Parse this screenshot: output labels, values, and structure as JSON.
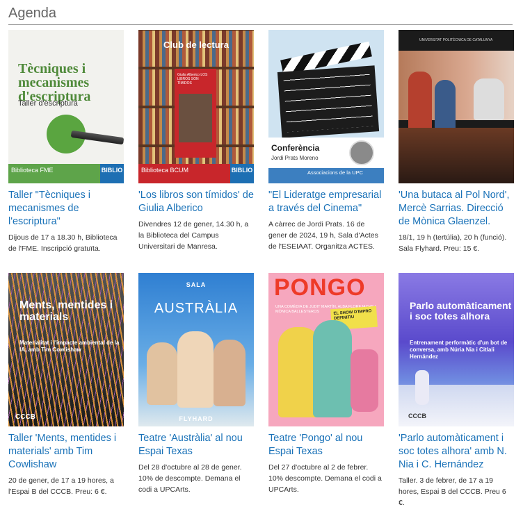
{
  "header": {
    "title": "Agenda"
  },
  "items": [
    {
      "title": "Taller \"Tècniques i mecanismes de l'escriptura\"",
      "desc": "Dijous de 17 a 18.30 h, Biblioteca de l'FME. Inscripció gratuïta.",
      "poster": {
        "heading": "Tècniques i mecanismes d'escriptura",
        "sub": "Taller d'escriptura",
        "footer": "Biblioteca FME",
        "badge": "BIBLIO"
      }
    },
    {
      "title": "'Los libros son tímidos' de Giulia Alberico",
      "desc": "Divendres 12 de gener, 14.30 h, a la Biblioteca del Campus Universitari de Manresa.",
      "poster": {
        "heading": "Club de lectura",
        "book_title": "Giulia Alberico LOS LIBROS SON TÍMIDOS",
        "footer": "Biblioteca BCUM",
        "badge": "BIBLIO"
      }
    },
    {
      "title": "\"El Lideratge empresarial a través del Cinema\"",
      "desc": "A càrrec de Jordi Prats. 16 de gener de 2024, 19 h, Sala d'Actes de l'ESEIAAT. Organitza ACTES.",
      "poster": {
        "heading": "Conferència",
        "name": "Jordi Prats Moreno",
        "footer": "Associacions de la UPC"
      }
    },
    {
      "title": "'Una butaca al Pol Nord', Mercè Sarrias. Direcció de Mònica Glaenzel.",
      "desc": "18/1, 19 h (tertúlia), 20 h (funció). Sala Flyhard. Preu: 15 €.",
      "poster": {
        "heading": "UNIVERSITAT POLITÈCNICA DE CATALUNYA"
      }
    },
    {
      "title": "Taller 'Ments, mentides i materials' amb Tim Cowlishaw",
      "desc": "20 de gener, de 17 a 19 hores, a l'Espai B del CCCB. Preu: 6 €.",
      "poster": {
        "heading": "Ments, mentides i materials",
        "sub": "Materialitat i l'impacte ambiental de la IA, amb Tim Cowlishaw",
        "logo": "CCCB"
      }
    },
    {
      "title": "Teatre 'Austràlia' al nou Espai Texas",
      "desc": "Del 28 d'octubre al 28 de gener. 10% de descompte. Demana el codi a UPCArts.",
      "poster": {
        "sala": "SALA",
        "heading": "AUSTRÀLIA",
        "footer": "FLYHARD"
      }
    },
    {
      "title": "Teatre 'Pongo' al nou Espai Texas",
      "desc": "Del 27 d'octubre al 2 de febrer. 10% descompte. Demana el codi a UPCArts.",
      "poster": {
        "heading": "PONGO",
        "sub": "UNA COMÈDIA DE JUDIT MARTÍN, ALBA FLOREJACHS I MÒNICA BALLESTEROS",
        "badge": "EL SHOW D'IMPRO DEFINITIU"
      }
    },
    {
      "title": "'Parlo automàticament i soc totes alhora' amb N. Nia i C. Hernández",
      "desc": "Taller. 3 de febrer, de 17 a 19 hores, Espai B del CCCB. Preu 6 €.",
      "poster": {
        "heading": "Parlo automàticament i soc totes alhora",
        "sub": "Entrenament performàtic d'un bot de conversa, amb Núria Nia i Citlali Hernández",
        "logo": "CCCB"
      }
    }
  ]
}
